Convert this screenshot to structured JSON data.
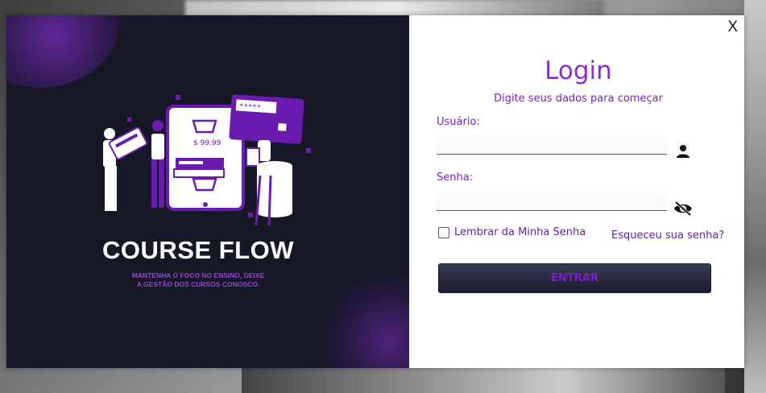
{
  "brand": {
    "name": "COURSE FLOW",
    "tagline_line1": "MANTENHA O FOCO NO ENSINO, DEIXE",
    "tagline_line2": "A GESTÃO DOS CURSOS CONOSCO.",
    "illustration": {
      "price": "$ 99.99",
      "password_mask": "*****"
    }
  },
  "dialog": {
    "close_label": "X",
    "title": "Login",
    "subtitle": "Digite seus dados para começar",
    "username": {
      "label": "Usuário:",
      "value": "",
      "icon": "person-icon"
    },
    "password": {
      "label": "Senha:",
      "value": "",
      "icon": "eye-slash-icon"
    },
    "remember_label": "Lembrar da Minha Senha",
    "remember_checked": false,
    "forgot_label": "Esqueceu sua senha?",
    "submit_label": "ENTRAR"
  },
  "colors": {
    "accent": "#8a2be2",
    "panel_dark": "#161827",
    "button_bg": "#2a2c40"
  }
}
